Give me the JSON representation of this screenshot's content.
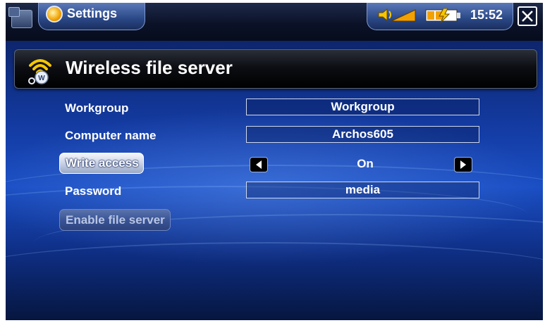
{
  "topbar": {
    "app_title": "Settings",
    "clock": "15:52",
    "icons": [
      "window-switch-icon",
      "settings-icon",
      "volume-icon",
      "battery-charging-icon",
      "close-icon"
    ]
  },
  "header": {
    "title": "Wireless file server",
    "icon": "wifi-server-icon"
  },
  "form": {
    "workgroup": {
      "label": "Workgroup",
      "value": "Workgroup"
    },
    "computer_name": {
      "label": "Computer name",
      "value": "Archos605"
    },
    "write_access": {
      "label": "Write access",
      "value": "On"
    },
    "password": {
      "label": "Password",
      "value": "media"
    },
    "enable_button": "Enable file server"
  },
  "colors": {
    "background": "#133aa0",
    "header": "#000000",
    "accent": "#f2a100"
  }
}
